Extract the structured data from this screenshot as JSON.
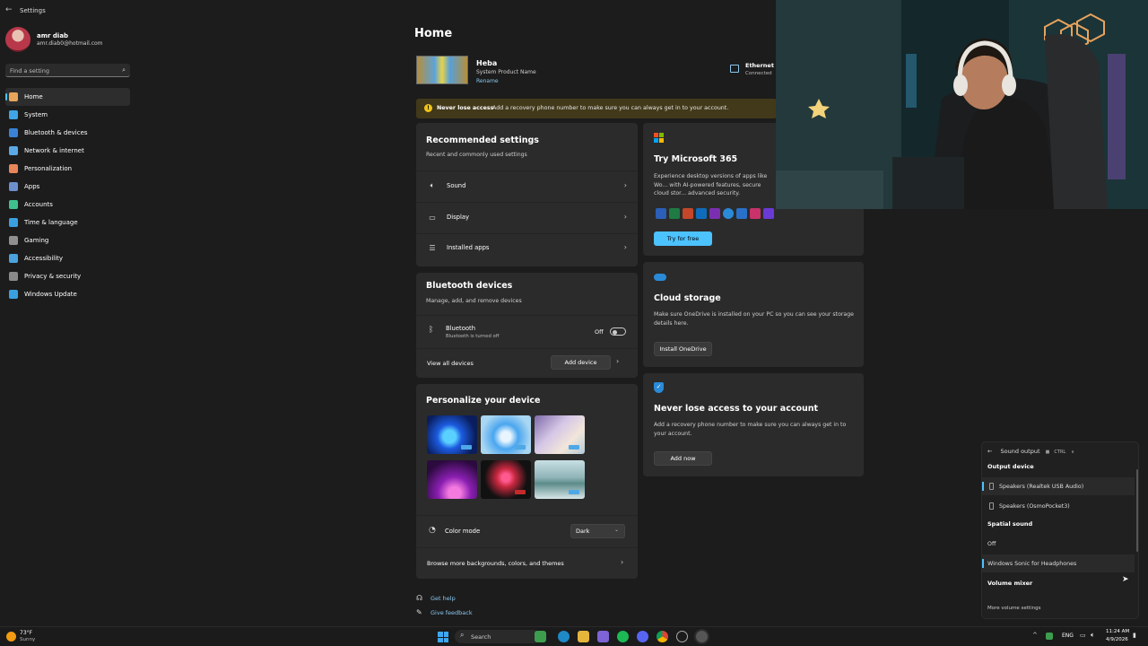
{
  "window": {
    "title": "Settings"
  },
  "profile": {
    "name": "amr diab",
    "email": "amr.diab0@hotmail.com"
  },
  "search": {
    "placeholder": "Find a setting"
  },
  "nav": [
    {
      "label": "Home",
      "icon": "home-icon",
      "color": "#e8a65b"
    },
    {
      "label": "System",
      "icon": "display-icon",
      "color": "#3fa5e6"
    },
    {
      "label": "Bluetooth & devices",
      "icon": "bluetooth-icon",
      "color": "#3a82d6"
    },
    {
      "label": "Network & internet",
      "icon": "wifi-icon",
      "color": "#5aa9e6"
    },
    {
      "label": "Personalization",
      "icon": "brush-icon",
      "color": "#e8865a"
    },
    {
      "label": "Apps",
      "icon": "apps-icon",
      "color": "#6c8fcf"
    },
    {
      "label": "Accounts",
      "icon": "person-icon",
      "color": "#3fc18d"
    },
    {
      "label": "Time & language",
      "icon": "globe-icon",
      "color": "#3aa0e0"
    },
    {
      "label": "Gaming",
      "icon": "gamepad-icon",
      "color": "#8f8f8f"
    },
    {
      "label": "Accessibility",
      "icon": "accessibility-icon",
      "color": "#4aa3df"
    },
    {
      "label": "Privacy & security",
      "icon": "shield-icon",
      "color": "#8a8a8a"
    },
    {
      "label": "Windows Update",
      "icon": "update-icon",
      "color": "#3a9fe0"
    }
  ],
  "home": {
    "title": "Home",
    "device": {
      "name": "Heba",
      "product": "System Product Name",
      "rename": "Rename"
    },
    "network": {
      "name": "Ethernet",
      "status": "Connected"
    },
    "banner": {
      "bold": "Never lose access",
      "text": "Add a recovery phone number to make sure you can always get in to your account."
    }
  },
  "recommended": {
    "title": "Recommended settings",
    "subtitle": "Recent and commonly used settings",
    "items": [
      {
        "label": "Sound",
        "icon": "speaker-icon"
      },
      {
        "label": "Display",
        "icon": "monitor-icon"
      },
      {
        "label": "Installed apps",
        "icon": "list-icon"
      }
    ]
  },
  "bluetooth": {
    "title": "Bluetooth devices",
    "subtitle": "Manage, add, and remove devices",
    "item_label": "Bluetooth",
    "item_sub": "Bluetooth is turned off",
    "state": "Off",
    "view_all": "View all devices",
    "add": "Add device"
  },
  "personalize": {
    "title": "Personalize your device",
    "color_mode_label": "Color mode",
    "color_mode_value": "Dark",
    "browse": "Browse more backgrounds, colors, and themes"
  },
  "m365": {
    "title": "Try Microsoft 365",
    "text": "Experience desktop versions of apps like Wo... with AI-powered features, secure cloud stor... advanced security.",
    "button": "Try for free"
  },
  "cloud": {
    "title": "Cloud storage",
    "text": "Make sure OneDrive is installed on your PC so you can see your storage details here.",
    "button": "Install OneDrive"
  },
  "account": {
    "title": "Never lose access to your account",
    "text": "Add a recovery phone number to make sure you can always get in to your account.",
    "button": "Add now"
  },
  "help": {
    "get_help": "Get help",
    "feedback": "Give feedback"
  },
  "sound_flyout": {
    "header": "Sound output",
    "shortcut": "CTRL",
    "output_title": "Output device",
    "outputs": [
      "Speakers (Realtek USB Audio)",
      "Speakers (OsmoPocket3)"
    ],
    "spatial_title": "Spatial sound",
    "spatial": [
      "Off",
      "Windows Sonic for Headphones"
    ],
    "mixer_title": "Volume mixer",
    "more": "More volume settings"
  },
  "taskbar": {
    "weather_temp": "73°F",
    "weather_desc": "Sunny",
    "search": "Search",
    "lang": "ENG",
    "time": "11:24 AM",
    "date": "4/9/2026"
  }
}
